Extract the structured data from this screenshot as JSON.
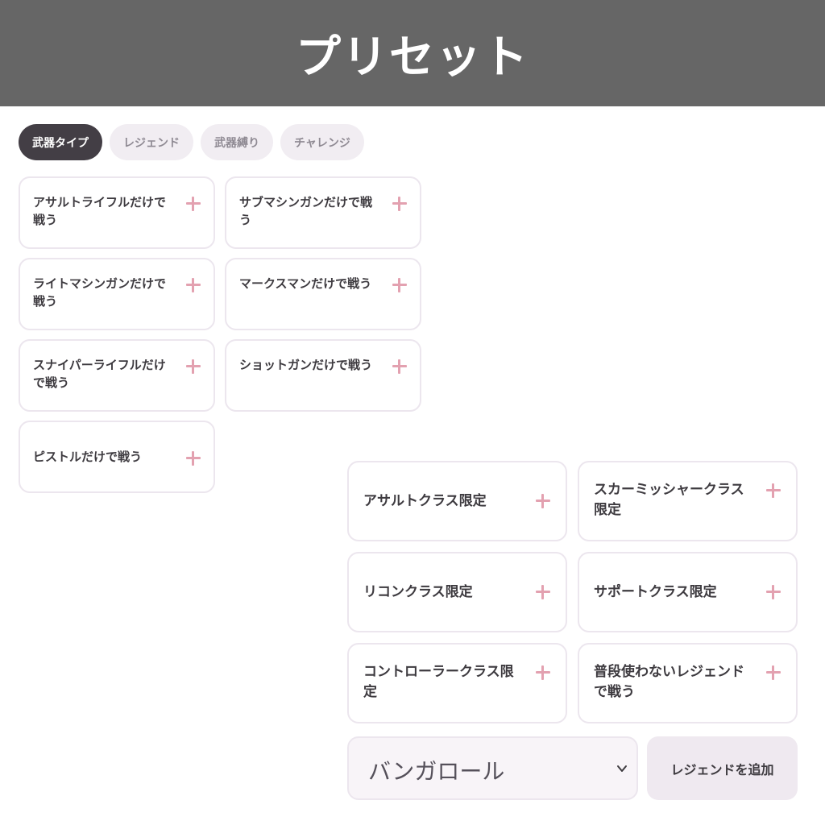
{
  "header": {
    "title": "プリセット"
  },
  "tabs": [
    {
      "label": "武器タイプ",
      "active": true
    },
    {
      "label": "レジェンド",
      "active": false
    },
    {
      "label": "武器縛り",
      "active": false
    },
    {
      "label": "チャレンジ",
      "active": false
    }
  ],
  "weapon_presets": [
    {
      "label": "アサルトライフルだけで戦う"
    },
    {
      "label": "サブマシンガンだけで戦う"
    },
    {
      "label": "ライトマシンガンだけで戦う"
    },
    {
      "label": "マークスマンだけで戦う"
    },
    {
      "label": "スナイパーライフルだけで戦う"
    },
    {
      "label": "ショットガンだけで戦う"
    },
    {
      "label": "ピストルだけで戦う"
    }
  ],
  "class_presets": [
    {
      "label": "アサルトクラス限定"
    },
    {
      "label": "スカーミッシャークラス限定"
    },
    {
      "label": "リコンクラス限定"
    },
    {
      "label": "サポートクラス限定"
    },
    {
      "label": "コントローラークラス限定"
    },
    {
      "label": "普段使わないレジェンドで戦う"
    }
  ],
  "legend_select": {
    "value": "バンガロール"
  },
  "add_legend_button": {
    "label": "レジェンドを追加"
  },
  "colors": {
    "header_bg": "#666666",
    "tab_active_bg": "#433e45",
    "tab_inactive_bg": "#f1edf2",
    "plus_accent": "#e3a1b0",
    "card_border": "#ece6ee"
  },
  "icons": {
    "add": "plus-icon",
    "dropdown": "chevron-down-icon"
  }
}
